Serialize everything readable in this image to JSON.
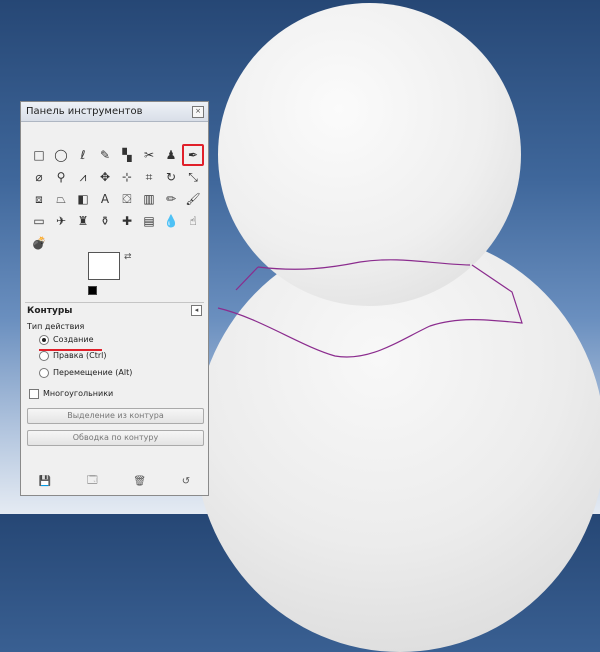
{
  "toolbox": {
    "title": "Панель инструментов",
    "close_glyph": "×",
    "tools": [
      {
        "name": "rect-select-icon",
        "glyph": "□"
      },
      {
        "name": "ellipse-select-icon",
        "glyph": "◯"
      },
      {
        "name": "free-select-icon",
        "glyph": "ℓ"
      },
      {
        "name": "fuzzy-select-icon",
        "glyph": "✎"
      },
      {
        "name": "color-select-icon",
        "glyph": "▚"
      },
      {
        "name": "scissors-icon",
        "glyph": "✂"
      },
      {
        "name": "foreground-select-icon",
        "glyph": "♟"
      },
      {
        "name": "paths-icon",
        "glyph": "✒"
      },
      {
        "name": "color-picker-icon",
        "glyph": "⌀"
      },
      {
        "name": "zoom-icon",
        "glyph": "⚲"
      },
      {
        "name": "measure-icon",
        "glyph": "⩘"
      },
      {
        "name": "move-icon",
        "glyph": "✥"
      },
      {
        "name": "align-icon",
        "glyph": "⊹"
      },
      {
        "name": "crop-icon",
        "glyph": "⌗"
      },
      {
        "name": "rotate-icon",
        "glyph": "↻"
      },
      {
        "name": "scale-icon",
        "glyph": "⤡"
      },
      {
        "name": "shear-icon",
        "glyph": "⧈"
      },
      {
        "name": "perspective-icon",
        "glyph": "⏢"
      },
      {
        "name": "flip-icon",
        "glyph": "◧"
      },
      {
        "name": "text-icon",
        "glyph": "A"
      },
      {
        "name": "bucket-fill-icon",
        "glyph": "⛋"
      },
      {
        "name": "blend-icon",
        "glyph": "▥"
      },
      {
        "name": "pencil-icon",
        "glyph": "✏"
      },
      {
        "name": "paintbrush-icon",
        "glyph": "🖌"
      },
      {
        "name": "eraser-icon",
        "glyph": "▭"
      },
      {
        "name": "airbrush-icon",
        "glyph": "✈"
      },
      {
        "name": "ink-icon",
        "glyph": "♜"
      },
      {
        "name": "clone-icon",
        "glyph": "⚱"
      },
      {
        "name": "heal-icon",
        "glyph": "✚"
      },
      {
        "name": "perspective-clone-icon",
        "glyph": "▤"
      },
      {
        "name": "blur-icon",
        "glyph": "💧"
      },
      {
        "name": "smudge-icon",
        "glyph": "☝"
      },
      {
        "name": "dodge-burn-icon",
        "glyph": "💣"
      }
    ],
    "selected_tool_index": 7,
    "swap_glyph": "⇄",
    "options": {
      "title": "Контуры",
      "expand_glyph": "◂",
      "mode_label": "Тип действия",
      "modes": [
        "Создание",
        "Правка (Ctrl)",
        "Перемещение (Alt)"
      ],
      "polygonal_label": "Многоугольники",
      "button_selection": "Выделение из контура",
      "button_stroke": "Обводка по контуру"
    },
    "bottom_icons": [
      {
        "name": "save-icon",
        "glyph": "💾"
      },
      {
        "name": "restore-icon",
        "glyph": "🗔"
      },
      {
        "name": "delete-icon",
        "glyph": "🗑"
      },
      {
        "name": "reset-icon",
        "glyph": "↺"
      }
    ]
  },
  "colors": {
    "path_stroke": "#8b2c8e",
    "highlight": "#e0202a"
  }
}
